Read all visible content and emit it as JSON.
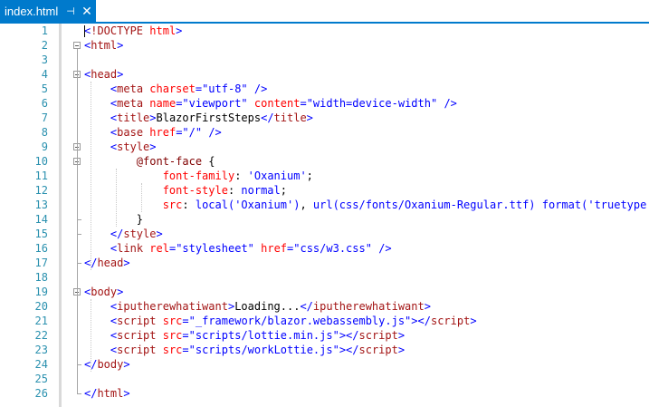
{
  "tab": {
    "title": "index.html",
    "pin_icon": "pin-icon",
    "close_icon": "close-icon"
  },
  "colors": {
    "accent": "#007acc",
    "line_number": "#2b91af",
    "tag": "#a31515",
    "attribute": "#ff0000",
    "value": "#0000ff"
  },
  "lines": [
    {
      "n": "1",
      "indent": "",
      "tokens": [
        {
          "c": "b",
          "v": "<"
        },
        {
          "c": "t",
          "v": "!DOCTYPE"
        },
        {
          "c": "x",
          "v": " "
        },
        {
          "c": "a",
          "v": "html"
        },
        {
          "c": "b",
          "v": ">"
        }
      ]
    },
    {
      "n": "2",
      "indent": "",
      "tokens": [
        {
          "c": "b",
          "v": "<"
        },
        {
          "c": "t",
          "v": "html"
        },
        {
          "c": "b",
          "v": ">"
        }
      ]
    },
    {
      "n": "3",
      "indent": "",
      "tokens": []
    },
    {
      "n": "4",
      "indent": "",
      "tokens": [
        {
          "c": "b",
          "v": "<"
        },
        {
          "c": "t",
          "v": "head"
        },
        {
          "c": "b",
          "v": ">"
        }
      ]
    },
    {
      "n": "5",
      "indent": "    ",
      "tokens": [
        {
          "c": "b",
          "v": "<"
        },
        {
          "c": "t",
          "v": "meta"
        },
        {
          "c": "x",
          "v": " "
        },
        {
          "c": "a",
          "v": "charset"
        },
        {
          "c": "b",
          "v": "=\"utf-8\""
        },
        {
          "c": "x",
          "v": " "
        },
        {
          "c": "b",
          "v": "/>"
        }
      ]
    },
    {
      "n": "6",
      "indent": "    ",
      "tokens": [
        {
          "c": "b",
          "v": "<"
        },
        {
          "c": "t",
          "v": "meta"
        },
        {
          "c": "x",
          "v": " "
        },
        {
          "c": "a",
          "v": "name"
        },
        {
          "c": "b",
          "v": "=\"viewport\""
        },
        {
          "c": "x",
          "v": " "
        },
        {
          "c": "a",
          "v": "content"
        },
        {
          "c": "b",
          "v": "=\"width=device-width\""
        },
        {
          "c": "x",
          "v": " "
        },
        {
          "c": "b",
          "v": "/>"
        }
      ]
    },
    {
      "n": "7",
      "indent": "    ",
      "tokens": [
        {
          "c": "b",
          "v": "<"
        },
        {
          "c": "t",
          "v": "title"
        },
        {
          "c": "b",
          "v": ">"
        },
        {
          "c": "x",
          "v": "BlazorFirstSteps"
        },
        {
          "c": "b",
          "v": "</"
        },
        {
          "c": "t",
          "v": "title"
        },
        {
          "c": "b",
          "v": ">"
        }
      ]
    },
    {
      "n": "8",
      "indent": "    ",
      "tokens": [
        {
          "c": "b",
          "v": "<"
        },
        {
          "c": "t",
          "v": "base"
        },
        {
          "c": "x",
          "v": " "
        },
        {
          "c": "a",
          "v": "href"
        },
        {
          "c": "b",
          "v": "=\"/\""
        },
        {
          "c": "x",
          "v": " "
        },
        {
          "c": "b",
          "v": "/>"
        }
      ]
    },
    {
      "n": "9",
      "indent": "    ",
      "tokens": [
        {
          "c": "b",
          "v": "<"
        },
        {
          "c": "t",
          "v": "style"
        },
        {
          "c": "b",
          "v": ">"
        }
      ]
    },
    {
      "n": "10",
      "indent": "        ",
      "tokens": [
        {
          "c": "cs",
          "v": "@font-face"
        },
        {
          "c": "x",
          "v": " {"
        }
      ]
    },
    {
      "n": "11",
      "indent": "            ",
      "tokens": [
        {
          "c": "cp",
          "v": "font-family"
        },
        {
          "c": "x",
          "v": ": "
        },
        {
          "c": "cv",
          "v": "'Oxanium'"
        },
        {
          "c": "x",
          "v": ";"
        }
      ]
    },
    {
      "n": "12",
      "indent": "            ",
      "tokens": [
        {
          "c": "cp",
          "v": "font-style"
        },
        {
          "c": "x",
          "v": ": "
        },
        {
          "c": "cv",
          "v": "normal"
        },
        {
          "c": "x",
          "v": ";"
        }
      ]
    },
    {
      "n": "13",
      "indent": "            ",
      "tokens": [
        {
          "c": "cp",
          "v": "src"
        },
        {
          "c": "x",
          "v": ": "
        },
        {
          "c": "cv",
          "v": "local('Oxanium')"
        },
        {
          "c": "x",
          "v": ", "
        },
        {
          "c": "cv",
          "v": "url(css/fonts/Oxanium-Regular.ttf)"
        },
        {
          "c": "x",
          "v": " "
        },
        {
          "c": "cv",
          "v": "format('truetype')"
        }
      ]
    },
    {
      "n": "14",
      "indent": "        ",
      "tokens": [
        {
          "c": "x",
          "v": "}"
        }
      ]
    },
    {
      "n": "15",
      "indent": "    ",
      "tokens": [
        {
          "c": "b",
          "v": "</"
        },
        {
          "c": "t",
          "v": "style"
        },
        {
          "c": "b",
          "v": ">"
        }
      ]
    },
    {
      "n": "16",
      "indent": "    ",
      "tokens": [
        {
          "c": "b",
          "v": "<"
        },
        {
          "c": "t",
          "v": "link"
        },
        {
          "c": "x",
          "v": " "
        },
        {
          "c": "a",
          "v": "rel"
        },
        {
          "c": "b",
          "v": "=\"stylesheet\""
        },
        {
          "c": "x",
          "v": " "
        },
        {
          "c": "a",
          "v": "href"
        },
        {
          "c": "b",
          "v": "=\"css/w3.css\""
        },
        {
          "c": "x",
          "v": " "
        },
        {
          "c": "b",
          "v": "/>"
        }
      ]
    },
    {
      "n": "17",
      "indent": "",
      "tokens": [
        {
          "c": "b",
          "v": "</"
        },
        {
          "c": "t",
          "v": "head"
        },
        {
          "c": "b",
          "v": ">"
        }
      ]
    },
    {
      "n": "18",
      "indent": "",
      "tokens": []
    },
    {
      "n": "19",
      "indent": "",
      "tokens": [
        {
          "c": "b",
          "v": "<"
        },
        {
          "c": "t",
          "v": "body"
        },
        {
          "c": "b",
          "v": ">"
        }
      ]
    },
    {
      "n": "20",
      "indent": "    ",
      "tokens": [
        {
          "c": "b",
          "v": "<"
        },
        {
          "c": "t",
          "v": "iputherewhatiwant"
        },
        {
          "c": "b",
          "v": ">"
        },
        {
          "c": "x",
          "v": "Loading..."
        },
        {
          "c": "b",
          "v": "</"
        },
        {
          "c": "t",
          "v": "iputherewhatiwant"
        },
        {
          "c": "b",
          "v": ">"
        }
      ]
    },
    {
      "n": "21",
      "indent": "    ",
      "tokens": [
        {
          "c": "b",
          "v": "<"
        },
        {
          "c": "t",
          "v": "script"
        },
        {
          "c": "x",
          "v": " "
        },
        {
          "c": "a",
          "v": "src"
        },
        {
          "c": "b",
          "v": "=\"_framework/blazor.webassembly.js\""
        },
        {
          "c": "b",
          "v": "></"
        },
        {
          "c": "t",
          "v": "script"
        },
        {
          "c": "b",
          "v": ">"
        }
      ]
    },
    {
      "n": "22",
      "indent": "    ",
      "tokens": [
        {
          "c": "b",
          "v": "<"
        },
        {
          "c": "t",
          "v": "script"
        },
        {
          "c": "x",
          "v": " "
        },
        {
          "c": "a",
          "v": "src"
        },
        {
          "c": "b",
          "v": "=\"scripts/lottie.min.js\""
        },
        {
          "c": "b",
          "v": "></"
        },
        {
          "c": "t",
          "v": "script"
        },
        {
          "c": "b",
          "v": ">"
        }
      ]
    },
    {
      "n": "23",
      "indent": "    ",
      "tokens": [
        {
          "c": "b",
          "v": "<"
        },
        {
          "c": "t",
          "v": "script"
        },
        {
          "c": "x",
          "v": " "
        },
        {
          "c": "a",
          "v": "src"
        },
        {
          "c": "b",
          "v": "=\"scripts/workLottie.js\""
        },
        {
          "c": "b",
          "v": "></"
        },
        {
          "c": "t",
          "v": "script"
        },
        {
          "c": "b",
          "v": ">"
        }
      ]
    },
    {
      "n": "24",
      "indent": "",
      "tokens": [
        {
          "c": "b",
          "v": "</"
        },
        {
          "c": "t",
          "v": "body"
        },
        {
          "c": "b",
          "v": ">"
        }
      ]
    },
    {
      "n": "25",
      "indent": "",
      "tokens": []
    },
    {
      "n": "26",
      "indent": "",
      "tokens": [
        {
          "c": "b",
          "v": "</"
        },
        {
          "c": "t",
          "v": "html"
        },
        {
          "c": "b",
          "v": ">"
        }
      ]
    }
  ]
}
